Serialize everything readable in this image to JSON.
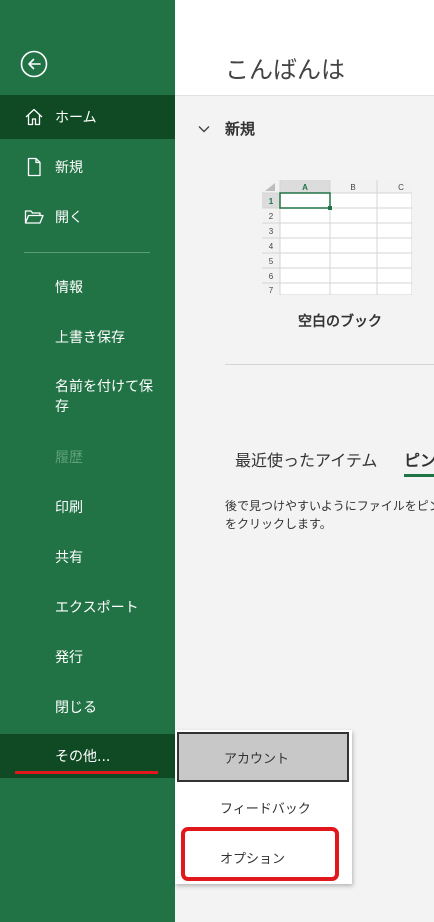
{
  "sidebar": {
    "items": {
      "home": "ホーム",
      "new": "新規",
      "open": "開く",
      "info": "情報",
      "save": "上書き保存",
      "save_as": "名前を付けて保存",
      "history": "履歴",
      "print": "印刷",
      "share": "共有",
      "export": "エクスポート",
      "publish": "発行",
      "close": "閉じる",
      "more": "その他..."
    }
  },
  "main": {
    "greeting": "こんばんは",
    "new_section_title": "新規",
    "blank_workbook_label": "空白のブック",
    "spreadsheet": {
      "columns": [
        "A",
        "B",
        "C"
      ],
      "rows": [
        "1",
        "2",
        "3",
        "4",
        "5",
        "6",
        "7"
      ]
    },
    "tabs": {
      "recent": "最近使ったアイテム",
      "pinned": "ピン"
    },
    "pinned_description": "後で見つけやすいようにファイルをピン\nをクリックします。"
  },
  "popup_menu": {
    "account": "アカウント",
    "feedback": "フィードバック",
    "options": "オプション"
  },
  "colors": {
    "sidebar_green": "#217346",
    "active_dark_green": "#0f4a24",
    "highlight_red": "#e0171c"
  },
  "icons": [
    "back-arrow-icon",
    "home-icon",
    "new-file-icon",
    "open-folder-icon",
    "chevron-down-icon"
  ]
}
